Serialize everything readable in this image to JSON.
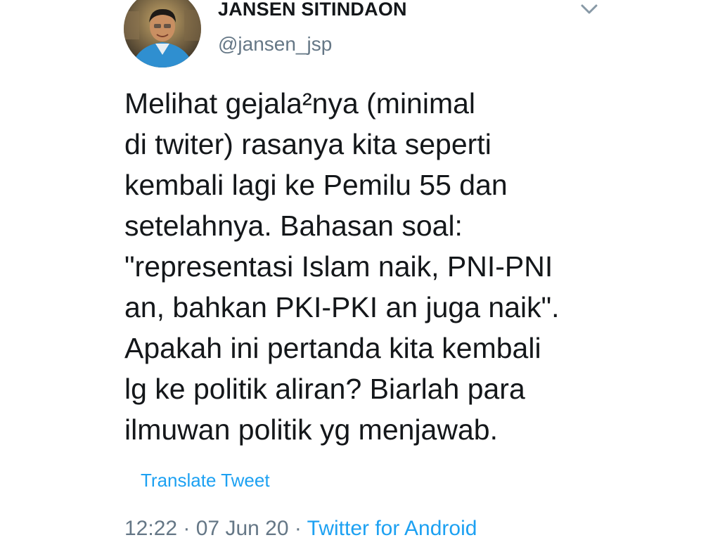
{
  "author": {
    "display_name": "JANSEN SITINDAON",
    "handle": "@jansen_jsp",
    "avatar_icon": "profile-photo"
  },
  "menu": {
    "icon": "chevron-down-icon"
  },
  "tweet": {
    "text": "Melihat gejala²nya (minimal\ndi twiter) rasanya kita seperti\nkembali lagi ke Pemilu 55 dan\nsetelahnya. Bahasan soal:\n\"representasi Islam naik, PNI-PNI\nan, bahkan PKI-PKI an juga naik\".\nApakah ini pertanda kita kembali\nlg ke politik aliran? Biarlah para\nilmuwan politik yg menjawab.",
    "translate_label": "Translate Tweet"
  },
  "meta": {
    "time": "12:22",
    "separator": " · ",
    "date": "07 Jun 20",
    "source": "Twitter for Android"
  },
  "colors": {
    "text": "#14171a",
    "secondary": "#657786",
    "link": "#1da1f2"
  }
}
